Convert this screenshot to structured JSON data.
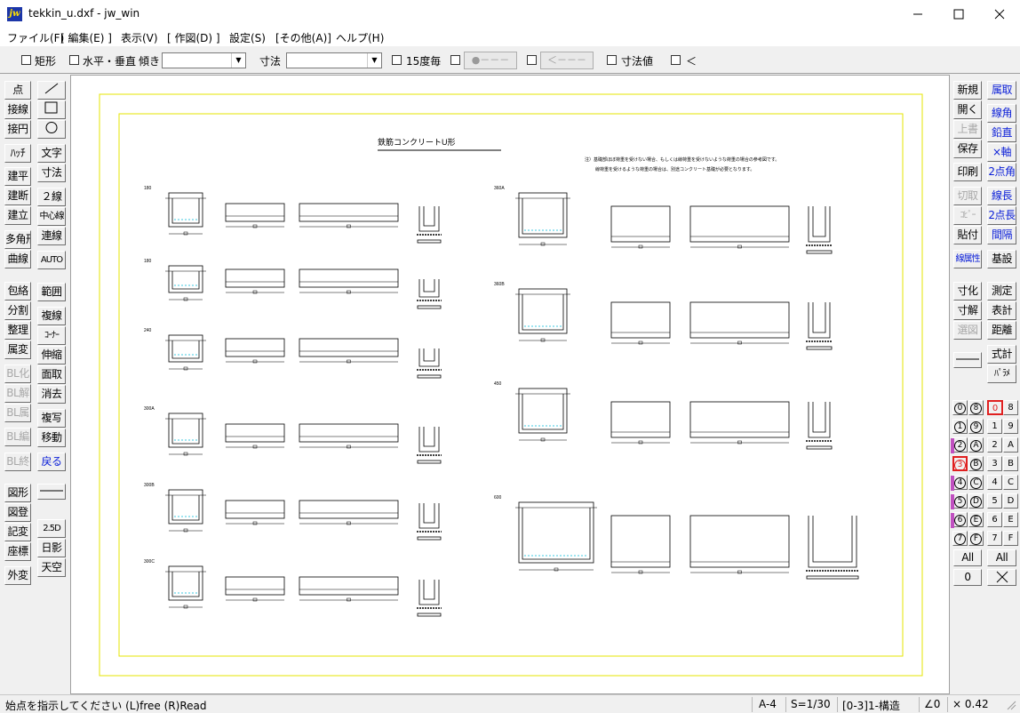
{
  "window": {
    "title": "tekkin_u.dxf - jw_win",
    "icon_text": "jw"
  },
  "menu": [
    "ファイル(F)",
    "[ 編集(E) ]",
    "表示(V)",
    "[ 作図(D) ]",
    "設定(S)",
    "[その他(A)]",
    "ヘルプ(H)"
  ],
  "toolbar": {
    "rect_label": "矩形",
    "hv_label": "水平・垂直",
    "slope_label": "傾き",
    "dim_label": "寸法",
    "deg15_label": "15度毎",
    "btn_a": "●－－－",
    "btn_b": "＜－－－",
    "dimval_label": "寸法値",
    "lt_label": "＜"
  },
  "left_tools": {
    "col1": [
      "点",
      "接線",
      "接円",
      "ﾊｯﾁ",
      "建平",
      "建断",
      "建立",
      "多角形",
      "曲線",
      "包絡",
      "分割",
      "整理",
      "属変",
      "BL化",
      "BL解",
      "BL属",
      "BL編",
      "BL終",
      "図形",
      "図登",
      "記変",
      "座標",
      "外変"
    ],
    "col2": [
      "文字",
      "寸法",
      "２線",
      "中心線",
      "連線",
      "AUTO",
      "範囲",
      "複線",
      "ｺｰﾅｰ",
      "伸縮",
      "面取",
      "消去",
      "複写",
      "移動",
      "戻る",
      "2.5D",
      "日影",
      "天空"
    ]
  },
  "right_tools": {
    "col1": [
      "新規",
      "開く",
      "上書",
      "保存",
      "印刷",
      "切取",
      "ｺﾋﾟｰ",
      "貼付",
      "線属性",
      "寸化",
      "寸解",
      "選図"
    ],
    "col2": [
      "属取",
      "線角",
      "鉛直",
      "×軸",
      "2点角",
      "線長",
      "2点長",
      "間隔",
      "基設",
      "測定",
      "表計",
      "距離",
      "式計",
      "ﾊﾟﾗﾒ"
    ],
    "layer_groups": [
      "0",
      "8",
      "1",
      "9",
      "2",
      "A",
      "3",
      "B",
      "4",
      "C",
      "5",
      "D",
      "6",
      "E",
      "7",
      "F"
    ],
    "layers": [
      "0",
      "8",
      "1",
      "9",
      "2",
      "A",
      "3",
      "B",
      "4",
      "C",
      "5",
      "D",
      "6",
      "E",
      "7",
      "F"
    ],
    "all_label": "All",
    "zero_label": "0"
  },
  "drawing": {
    "title": "鉄筋コンクリートU形",
    "note1": "注）基礎部ほぼ荷重を受けない場合、もしくは線荷重を受けないような荷重の場合の参考図です。",
    "note2": "線荷重を受けるような荷重の場合は、別途コンクリート基礎が必要となります。",
    "rows_left": [
      "180",
      "180",
      "240",
      "300A",
      "300B",
      "300C"
    ],
    "rows_right": [
      "360A",
      "360B",
      "450",
      "600"
    ]
  },
  "status": {
    "message": "始点を指示してください (L)free (R)Read",
    "paper": "A-4",
    "scale": "S=1/30",
    "layer": "[0-3]1-構造",
    "angle": "∠0",
    "zoom": "× 0.42"
  },
  "colors": {
    "frame": "#e6e600",
    "accent_blue": "#0a1ed8",
    "layer_red": "#e02020",
    "cyan": "#00b8d8"
  }
}
